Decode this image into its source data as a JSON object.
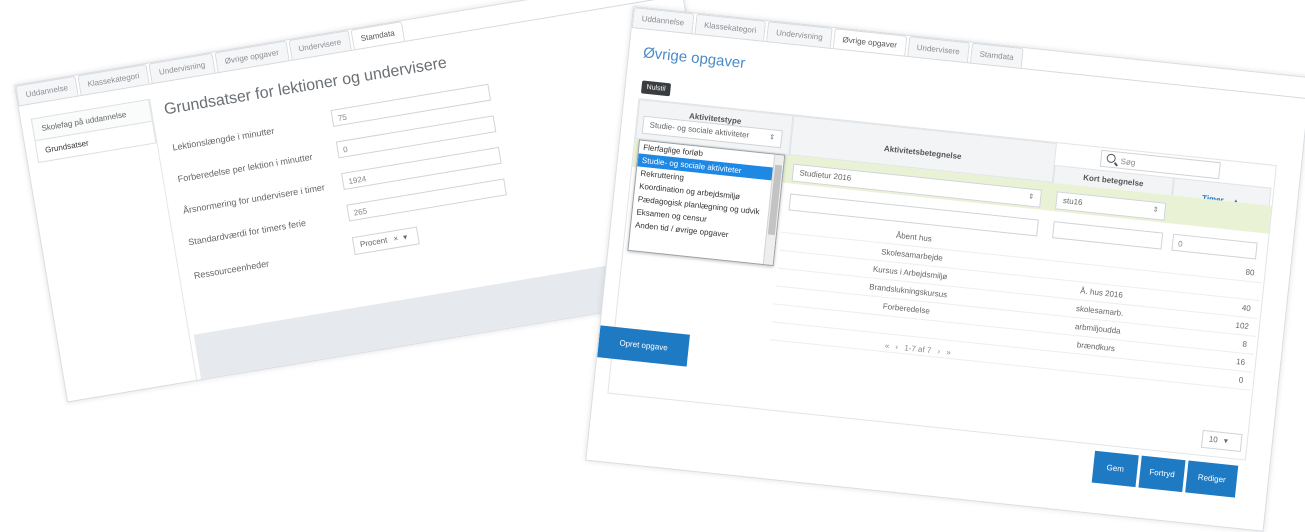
{
  "left_panel": {
    "tabs": [
      "Uddannelse",
      "Klassekategori",
      "Undervisning",
      "Øvrige opgaver",
      "Undervisere",
      "Stamdata"
    ],
    "active_tab": "Stamdata",
    "sidebar": [
      "Skolefag på uddannelse",
      "Grundsatser"
    ],
    "title": "Grundsatser for lektioner og undervisere",
    "fields": [
      {
        "label": "Lektionslængde i minutter",
        "value": "75"
      },
      {
        "label": "Forberedelse per lektion i minutter",
        "value": "0"
      },
      {
        "label": "Årsnormering for undervisere i timer",
        "value": "1924"
      },
      {
        "label": "Standardværdi for timers ferie",
        "value": "265"
      },
      {
        "label": "Ressourceenheder",
        "value": "Procent"
      }
    ],
    "select_clear": "×",
    "select_caret": "▾"
  },
  "right_panel": {
    "tabs": [
      "Uddannelse",
      "Klassekategori",
      "Undervisning",
      "Øvrige opgaver",
      "Undervisere",
      "Stamdata"
    ],
    "active_tab": "Øvrige opgaver",
    "title": "Øvrige opgaver",
    "new_button": "Nulstil",
    "columns": {
      "type": "Aktivitetstype",
      "name": "Aktivitetsbetegnelse",
      "short": "Kort betegnelse",
      "hours": "Timer"
    },
    "filter_values": {
      "type": "Studie- og sociale aktiviteter",
      "name": "Studietur 2016",
      "short": "stu16",
      "hours": "0"
    },
    "search_placeholder": "Søg",
    "rows": [
      {
        "name": "Åbent hus",
        "short": "",
        "hours": "80"
      },
      {
        "name": "Skolesamarbejde",
        "short": "",
        "hours": ""
      },
      {
        "name": "Kursus i Arbejdsmiljø",
        "short": "Å. hus 2016",
        "hours": "40"
      },
      {
        "name": "Brandslukningskursus",
        "short": "skolesamarb.",
        "hours": "102"
      },
      {
        "name": "Forberedelse",
        "short": "arbmiljoudda",
        "hours": "8"
      },
      {
        "name": "",
        "short": "brændkurs",
        "hours": "16"
      },
      {
        "name": "",
        "short": "",
        "hours": "0"
      }
    ],
    "dropdown_items": [
      "Flerfaglige forløb",
      "Studie- og sociale aktiviteter",
      "Rekruttering",
      "Koordination og arbejdsmiljø",
      "Pædagogisk planlægning og udvik",
      "Eksamen og censur",
      "Anden tid / øvrige opgaver"
    ],
    "dropdown_selected": "Studie- og sociale aktiviteter",
    "create_button": "Opret opgave",
    "pager_text": "1-7 af 7",
    "page_size": "10",
    "save_button": "Gem",
    "cancel_button": "Fortryd",
    "edit_button": "Rediger"
  },
  "colors": {
    "accent": "#1f7ac4",
    "filter_row": "#eaf2d6",
    "title_blue": "#4a8bc9"
  }
}
